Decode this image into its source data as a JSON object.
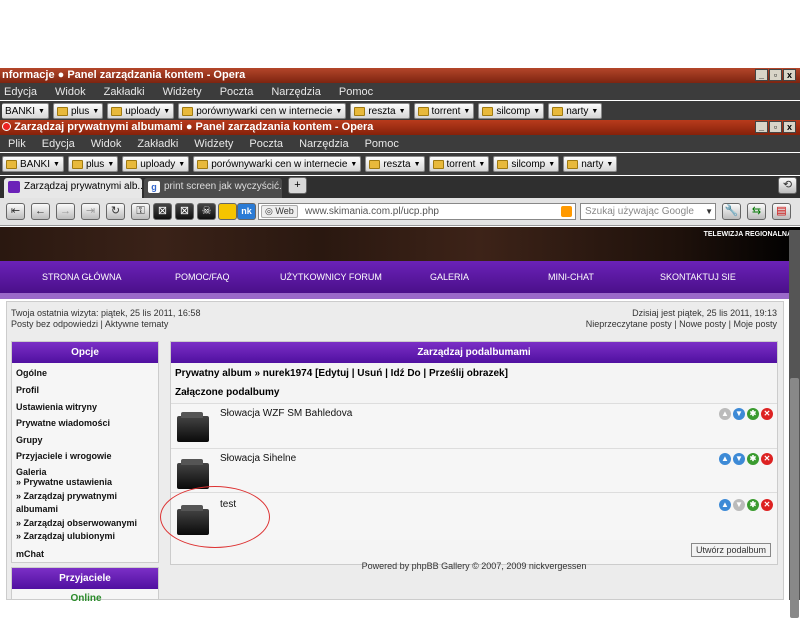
{
  "window1": {
    "title": "nformacje ● Panel zarządzania kontem - Opera",
    "menu": [
      "Edycja",
      "Widok",
      "Zakładki",
      "Widżety",
      "Poczta",
      "Narzędzia",
      "Pomoc"
    ],
    "bookmarks": [
      "BANKI",
      "plus",
      "uploady",
      "porównywarki cen w internecie",
      "reszta",
      "torrent",
      "silcomp",
      "narty"
    ]
  },
  "window2": {
    "title": "Zarządzaj prywatnymi albumami ● Panel zarządzania kontem - Opera",
    "menu": [
      "Plik",
      "Edycja",
      "Widok",
      "Zakładki",
      "Widżety",
      "Poczta",
      "Narzędzia",
      "Pomoc"
    ],
    "bookmarks": [
      "BANKI",
      "plus",
      "uploady",
      "porównywarki cen w internecie",
      "reszta",
      "torrent",
      "silcomp",
      "narty"
    ]
  },
  "winbtns": [
    "_",
    "▫",
    "x"
  ],
  "tabs": [
    {
      "label": "Zarządzaj prywatnymi alb..."
    },
    {
      "label": "print screen jak wyczyścić..."
    }
  ],
  "address": {
    "web": "Web",
    "url": "www.skimania.com.pl/ucp.php",
    "search_placeholder": "Szukaj używając Google"
  },
  "banner": {
    "tv": "TELEWIZJA REGIONALNA"
  },
  "topnav": [
    "STRONA GŁÓWNA",
    "POMOC/FAQ",
    "UŻYTKOWNICY FORUM",
    "GALERIA",
    "MINI-CHAT",
    "SKONTAKTUJ SIE"
  ],
  "visit": {
    "left1": "Twoja ostatnia wizyta: piątek, 25 lis 2011, 16:58",
    "left2": "Posty bez odpowiedzi | Aktywne tematy",
    "right1": "Dzisiaj jest piątek, 25 lis 2011, 19:13",
    "right2": "Nieprzeczytane posty | Nowe posty | Moje posty"
  },
  "sidebar": {
    "header": "Opcje",
    "items": [
      "Ogólne",
      "Profil",
      "Ustawienia witryny",
      "Prywatne wiadomości",
      "Grupy",
      "Przyjaciele i wrogowie",
      "Galeria"
    ],
    "galeria_sub": [
      "» Prywatne ustawienia",
      "» Zarządzaj prywatnymi",
      "albumami",
      "» Zarządzaj obserwowanymi",
      "» Zarządzaj ulubionymi"
    ],
    "mchat": "mChat"
  },
  "friends": {
    "header": "Przyjaciele",
    "online": "Online"
  },
  "main": {
    "header": "Zarządzaj podalbumami",
    "crumb": "Prywatny album » nurek1974 [Edytuj | Usuń | Idź Do | Prześlij obrazek]",
    "subheader": "Załączone podalbumy",
    "albums": [
      {
        "name": "Słowacja WZF SM Bahledova"
      },
      {
        "name": "Słowacja Sihelne"
      },
      {
        "name": "test"
      }
    ],
    "create_btn": "Utwórz podalbum"
  },
  "footer": "Powered by phpBB Gallery © 2007, 2009 nickvergessen"
}
